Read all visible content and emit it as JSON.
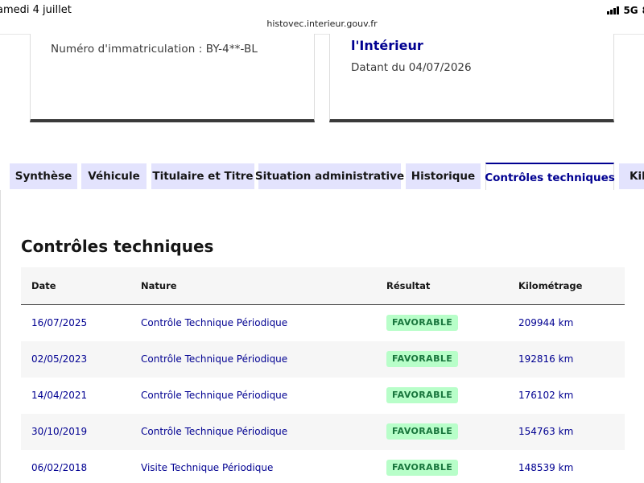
{
  "status_bar": {
    "date": "amedi 4 juillet",
    "url": "histovec.interieur.gouv.fr",
    "network": "5G",
    "battery": "8"
  },
  "cards": {
    "left": {
      "registration": "Numéro d'immatriculation : BY-4**-BL"
    },
    "right": {
      "title": "l'Intérieur",
      "dated": "Datant du 04/07/2026"
    }
  },
  "tabs": [
    {
      "label": "Synthèse",
      "active": false
    },
    {
      "label": "Véhicule",
      "active": false
    },
    {
      "label": "Titulaire et Titre",
      "active": false
    },
    {
      "label": "Situation administrative",
      "active": false
    },
    {
      "label": "Historique",
      "active": false
    },
    {
      "label": "Contrôles techniques",
      "active": true
    },
    {
      "label": "Kil",
      "active": false
    }
  ],
  "panel": {
    "title": "Contrôles techniques",
    "table": {
      "headers": {
        "date": "Date",
        "nature": "Nature",
        "result": "Résultat",
        "km": "Kilométrage"
      },
      "rows": [
        {
          "date": "16/07/2025",
          "nature": "Contrôle Technique Périodique",
          "result": "FAVORABLE",
          "km": "209944 km"
        },
        {
          "date": "02/05/2023",
          "nature": "Contrôle Technique Périodique",
          "result": "FAVORABLE",
          "km": "192816 km"
        },
        {
          "date": "14/04/2021",
          "nature": "Contrôle Technique Périodique",
          "result": "FAVORABLE",
          "km": "176102 km"
        },
        {
          "date": "30/10/2019",
          "nature": "Contrôle Technique Périodique",
          "result": "FAVORABLE",
          "km": "154763 km"
        },
        {
          "date": "06/02/2018",
          "nature": "Visite Technique Périodique",
          "result": "FAVORABLE",
          "km": "148539 km"
        }
      ]
    }
  },
  "colors": {
    "accent": "#000091",
    "tab_bg": "#e3e3fd",
    "badge_bg": "#b8fec9",
    "badge_text": "#18753c",
    "row_alt": "#f6f6f6"
  }
}
